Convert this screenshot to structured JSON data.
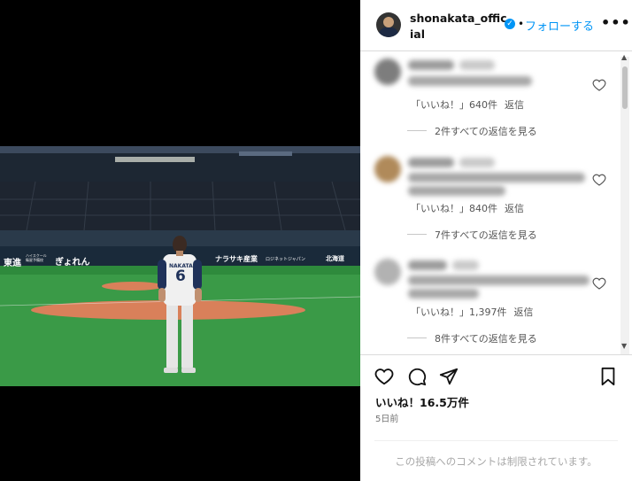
{
  "post": {
    "username": "shonakata_official",
    "follow_label": "フォローする",
    "dot": "•",
    "more": "•••"
  },
  "photo": {
    "banners": [
      "東進",
      "ハイスクール 衛星予備校",
      "ぎょれん",
      "ナラサキ産業",
      "ロジネットジャパン",
      "北海道"
    ],
    "jersey_name": "NAKATA",
    "jersey_number": "6"
  },
  "comments": [
    {
      "likes_label": "「いいね！」640件",
      "reply_label": "返信",
      "view_replies": "2件すべての返信を見る"
    },
    {
      "likes_label": "「いいね！」840件",
      "reply_label": "返信",
      "view_replies": "7件すべての返信を見る"
    },
    {
      "likes_label": "「いいね！」1,397件",
      "reply_label": "返信",
      "view_replies": "8件すべての返信を見る"
    }
  ],
  "footer": {
    "likes_total": "いいね！16.5万件",
    "time_ago": "5日前",
    "comments_restricted": "この投稿へのコメントは制限されています。"
  },
  "icons": {
    "heart": "heart-icon",
    "comment": "comment-icon",
    "share": "share-icon",
    "bookmark": "bookmark-icon",
    "verified": "verified-badge-icon"
  },
  "colors": {
    "accent": "#0095f6",
    "field_green": "#3a9a47",
    "infield_dirt": "#d9805a"
  }
}
